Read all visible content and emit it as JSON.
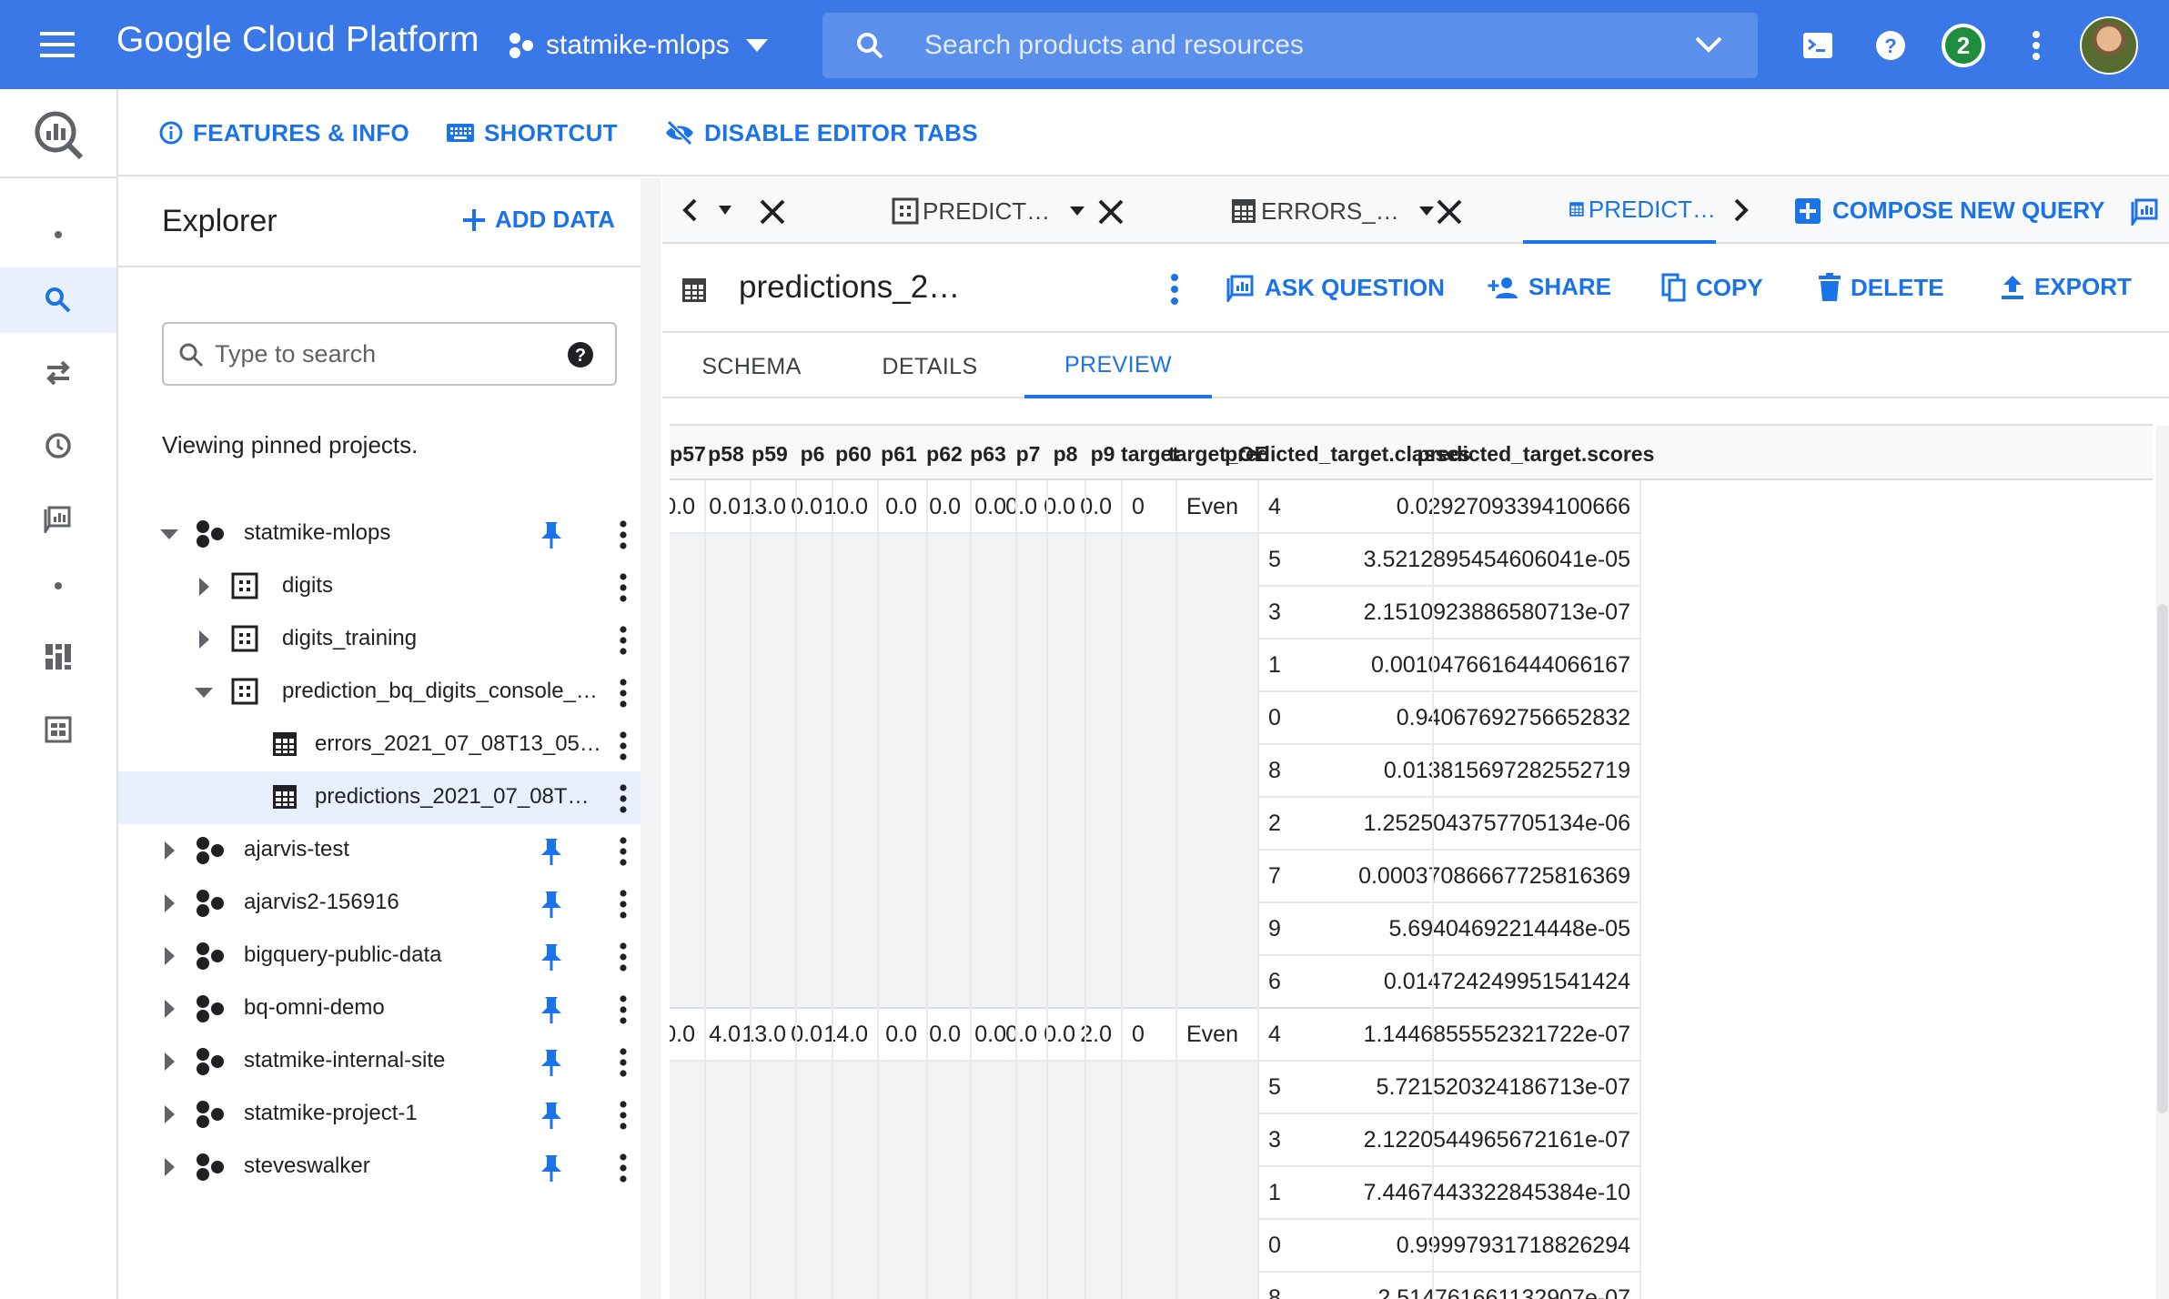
{
  "topbar": {
    "brand": "Google Cloud Platform",
    "project": "statmike-mlops",
    "search_placeholder": "Search products and resources",
    "notification_count": "2",
    "accent": "#3b78e7"
  },
  "toolbar2": {
    "features": "FEATURES & INFO",
    "shortcut": "SHORTCUT",
    "disable_tabs": "DISABLE EDITOR TABS"
  },
  "explorer": {
    "title": "Explorer",
    "add_data": "ADD DATA",
    "search_placeholder": "Type to search",
    "viewing": "Viewing pinned projects.",
    "tree": [
      {
        "label": "statmike-mlops",
        "level": 0,
        "type": "project",
        "expanded": true,
        "pinned": true
      },
      {
        "label": "digits",
        "level": 1,
        "type": "dataset",
        "expanded": false,
        "pinned": false
      },
      {
        "label": "digits_training",
        "level": 1,
        "type": "dataset",
        "expanded": false,
        "pinned": false
      },
      {
        "label": "prediction_bq_digits_console_…",
        "level": 1,
        "type": "dataset",
        "expanded": true,
        "pinned": false
      },
      {
        "label": "errors_2021_07_08T13_05…",
        "level": 2,
        "type": "table",
        "expanded": false,
        "pinned": false
      },
      {
        "label": "predictions_2021_07_08T…",
        "level": 2,
        "type": "table",
        "expanded": false,
        "pinned": false,
        "selected": true
      },
      {
        "label": "ajarvis-test",
        "level": 0,
        "type": "project",
        "expanded": false,
        "pinned": true
      },
      {
        "label": "ajarvis2-156916",
        "level": 0,
        "type": "project",
        "expanded": false,
        "pinned": true
      },
      {
        "label": "bigquery-public-data",
        "level": 0,
        "type": "project",
        "expanded": false,
        "pinned": true
      },
      {
        "label": "bq-omni-demo",
        "level": 0,
        "type": "project",
        "expanded": false,
        "pinned": true
      },
      {
        "label": "statmike-internal-site",
        "level": 0,
        "type": "project",
        "expanded": false,
        "pinned": true
      },
      {
        "label": "statmike-project-1",
        "level": 0,
        "type": "project",
        "expanded": false,
        "pinned": true
      },
      {
        "label": "steveswalker",
        "level": 0,
        "type": "project",
        "expanded": false,
        "pinned": true
      }
    ]
  },
  "tabs": {
    "items": [
      {
        "label": "PREDICT…",
        "active": false
      },
      {
        "label": "ERRORS_…",
        "active": false
      },
      {
        "label": "PREDICT…",
        "active": true
      }
    ],
    "compose": "COMPOSE NEW QUERY"
  },
  "table_header": {
    "title": "predictions_2…",
    "ask_question": "ASK QUESTION",
    "share": "SHARE",
    "copy": "COPY",
    "delete": "DELETE",
    "export": "EXPORT"
  },
  "subtabs": [
    "SCHEMA",
    "DETAILS",
    "PREVIEW"
  ],
  "grid": {
    "columns": [
      "p57",
      "p58",
      "p59",
      "p6",
      "p60",
      "p61",
      "p62",
      "p63",
      "p7",
      "p8",
      "p9",
      "target",
      "target_OE",
      "predicted_target.classes",
      "predicted_target.scores"
    ],
    "records": [
      {
        "values": [
          "0.0",
          "0.0",
          "13.0",
          "0.0",
          "10.0",
          "0.0",
          "0.0",
          "0.0",
          "0.0",
          "0.0",
          "0.0",
          "0",
          "Even"
        ],
        "predictions": [
          [
            "4",
            "0.02927093394100666"
          ],
          [
            "5",
            "3.5212895454606041e-05"
          ],
          [
            "3",
            "2.1510923886580713e-07"
          ],
          [
            "1",
            "0.0010476616444066167"
          ],
          [
            "0",
            "0.94067692756652832"
          ],
          [
            "8",
            "0.013815697282552719"
          ],
          [
            "2",
            "1.2525043757705134e-06"
          ],
          [
            "7",
            "0.00037086667725816369"
          ],
          [
            "9",
            "5.69404692214448e-05"
          ],
          [
            "6",
            "0.014724249951541424"
          ]
        ]
      },
      {
        "values": [
          "0.0",
          "4.0",
          "13.0",
          "0.0",
          "14.0",
          "0.0",
          "0.0",
          "0.0",
          "0.0",
          "0.0",
          "2.0",
          "0",
          "Even"
        ],
        "predictions": [
          [
            "4",
            "1.1446855552321722e-07"
          ],
          [
            "5",
            "5.721520324186713e-07"
          ],
          [
            "3",
            "2.1220544965672161e-07"
          ],
          [
            "1",
            "7.4467443322845384e-10"
          ],
          [
            "0",
            "0.99997931718826294"
          ],
          [
            "8",
            "2.514761661132907e-07"
          ]
        ]
      }
    ]
  }
}
